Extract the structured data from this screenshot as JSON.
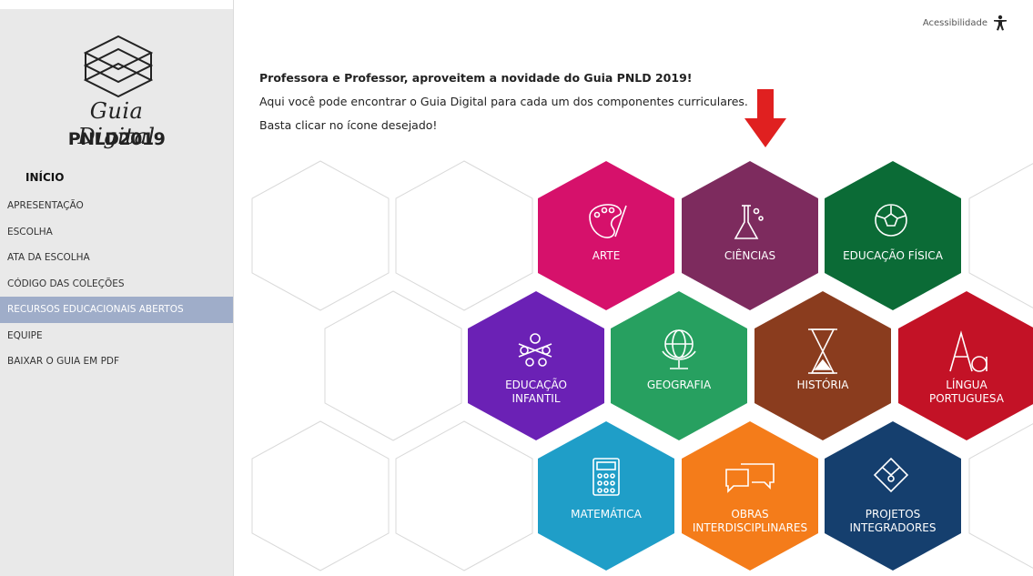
{
  "sidebar": {
    "logo_script": "Guia Digital",
    "logo_sub": "PNLD2019",
    "home": "INÍCIO",
    "items": [
      {
        "label": "APRESENTAÇÃO"
      },
      {
        "label": "ESCOLHA"
      },
      {
        "label": "ATA DA ESCOLHA"
      },
      {
        "label": "CÓDIGO DAS COLEÇÕES"
      },
      {
        "label": "RECURSOS EDUCACIONAIS ABERTOS",
        "active": true
      },
      {
        "label": "EQUIPE"
      },
      {
        "label": "BAIXAR O GUIA EM PDF"
      }
    ]
  },
  "header": {
    "accessibility": "Acessibilidade"
  },
  "intro": {
    "line1": "Professora e Professor, aproveitem a novidade do Guia PNLD 2019!",
    "line2": "Aqui você pode encontrar o Guia Digital para cada um dos componentes curriculares.",
    "line3": "Basta clicar no ícone desejado!"
  },
  "subjects": {
    "arte": {
      "label": "ARTE",
      "color": "#d6116b",
      "icon": "palette-icon"
    },
    "ciencias": {
      "label": "CIÊNCIAS",
      "color": "#7d2b5e",
      "icon": "flask-icon"
    },
    "educacao_fisica": {
      "label": "EDUCAÇÃO FÍSICA",
      "color": "#0b6b36",
      "icon": "soccer-ball-icon"
    },
    "educacao_infantil": {
      "label1": "EDUCAÇÃO",
      "label2": "INFANTIL",
      "color": "#6b21b5",
      "icon": "children-icon"
    },
    "geografia": {
      "label": "GEOGRAFIA",
      "color": "#27a060",
      "icon": "globe-icon"
    },
    "historia": {
      "label": "HISTÓRIA",
      "color": "#8a3c1e",
      "icon": "hourglass-icon"
    },
    "lingua": {
      "label1": "LÍNGUA",
      "label2": "PORTUGUESA",
      "color": "#c31226",
      "icon": "letters-icon"
    },
    "matematica": {
      "label": "MATEMÁTICA",
      "color": "#1f9ec8",
      "icon": "calculator-icon"
    },
    "obras": {
      "label1": "OBRAS",
      "label2": "INTERDISCIPLINARES",
      "color": "#f47c1a",
      "icon": "speech-bubbles-icon"
    },
    "projetos": {
      "label1": "PROJETOS",
      "label2": "INTEGRADORES",
      "color": "#153f6e",
      "icon": "puzzle-icon"
    }
  },
  "colors": {
    "sidebar_bg": "#e9e9e9",
    "active_item": "#9fadc9",
    "arrow": "#e02020"
  }
}
